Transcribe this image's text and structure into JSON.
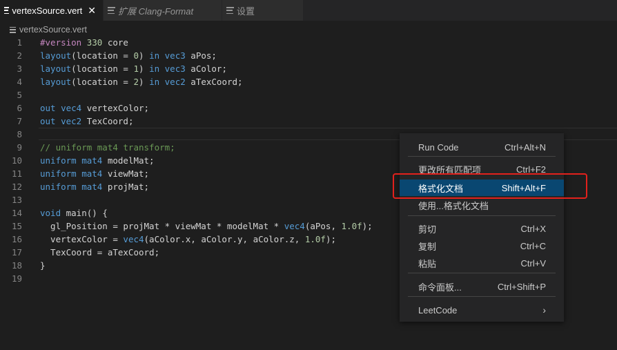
{
  "tabs": [
    {
      "label": "vertexSource.vert",
      "close": "✕"
    },
    {
      "label": "扩展 Clang-Format"
    },
    {
      "label": "设置"
    }
  ],
  "breadcrumb": "vertexSource.vert",
  "code_lines": [
    {
      "n": "1",
      "html": "<span class=\"pp\">#version</span> <span class=\"num\">330</span> core"
    },
    {
      "n": "2",
      "html": "<span class=\"kw\">layout</span>(location = <span class=\"num\">0</span>) <span class=\"kw\">in</span> <span class=\"kw\">vec3</span> aPos;"
    },
    {
      "n": "3",
      "html": "<span class=\"kw\">layout</span>(location = <span class=\"num\">1</span>) <span class=\"kw\">in</span> <span class=\"kw\">vec3</span> aColor;"
    },
    {
      "n": "4",
      "html": "<span class=\"kw\">layout</span>(location = <span class=\"num\">2</span>) <span class=\"kw\">in</span> <span class=\"kw\">vec2</span> aTexCoord;"
    },
    {
      "n": "5",
      "html": ""
    },
    {
      "n": "6",
      "html": "<span class=\"kw\">out</span> <span class=\"kw\">vec4</span> vertexColor;"
    },
    {
      "n": "7",
      "html": "<span class=\"kw\">out</span> <span class=\"kw\">vec2</span> TexCoord;"
    },
    {
      "n": "8",
      "html": ""
    },
    {
      "n": "9",
      "html": "<span class=\"cm\">// uniform mat4 transform;</span>"
    },
    {
      "n": "10",
      "html": "<span class=\"kw\">uniform</span> <span class=\"kw\">mat4</span> modelMat;"
    },
    {
      "n": "11",
      "html": "<span class=\"kw\">uniform</span> <span class=\"kw\">mat4</span> viewMat;"
    },
    {
      "n": "12",
      "html": "<span class=\"kw\">uniform</span> <span class=\"kw\">mat4</span> projMat;"
    },
    {
      "n": "13",
      "html": ""
    },
    {
      "n": "14",
      "html": "<span class=\"kw\">void</span> main() {"
    },
    {
      "n": "15",
      "html": "  gl_Position = projMat * viewMat * modelMat * <span class=\"kw\">vec4</span>(aPos, <span class=\"num\">1.0f</span>);"
    },
    {
      "n": "16",
      "html": "  vertexColor = <span class=\"kw\">vec4</span>(aColor.x, aColor.y, aColor.z, <span class=\"num\">1.0f</span>);"
    },
    {
      "n": "17",
      "html": "  TexCoord = aTexCoord;"
    },
    {
      "n": "18",
      "html": "}"
    },
    {
      "n": "19",
      "html": ""
    }
  ],
  "menu": {
    "items": [
      {
        "label": "Run Code",
        "key": "Ctrl+Alt+N"
      },
      {
        "label": "更改所有匹配项",
        "key": "Ctrl+F2"
      },
      {
        "label": "格式化文档",
        "key": "Shift+Alt+F",
        "highlighted": true
      },
      {
        "label": "使用...格式化文档",
        "key": ""
      },
      {
        "label": "剪切",
        "key": "Ctrl+X"
      },
      {
        "label": "复制",
        "key": "Ctrl+C"
      },
      {
        "label": "粘贴",
        "key": "Ctrl+V"
      },
      {
        "label": "命令面板...",
        "key": "Ctrl+Shift+P"
      },
      {
        "label": "LeetCode",
        "key": "",
        "submenu_arrow": "›"
      }
    ]
  },
  "colors": {
    "editor_bg": "#1e1e1e",
    "menu_highlight": "#094771",
    "annotation_red": "#e3211c"
  }
}
